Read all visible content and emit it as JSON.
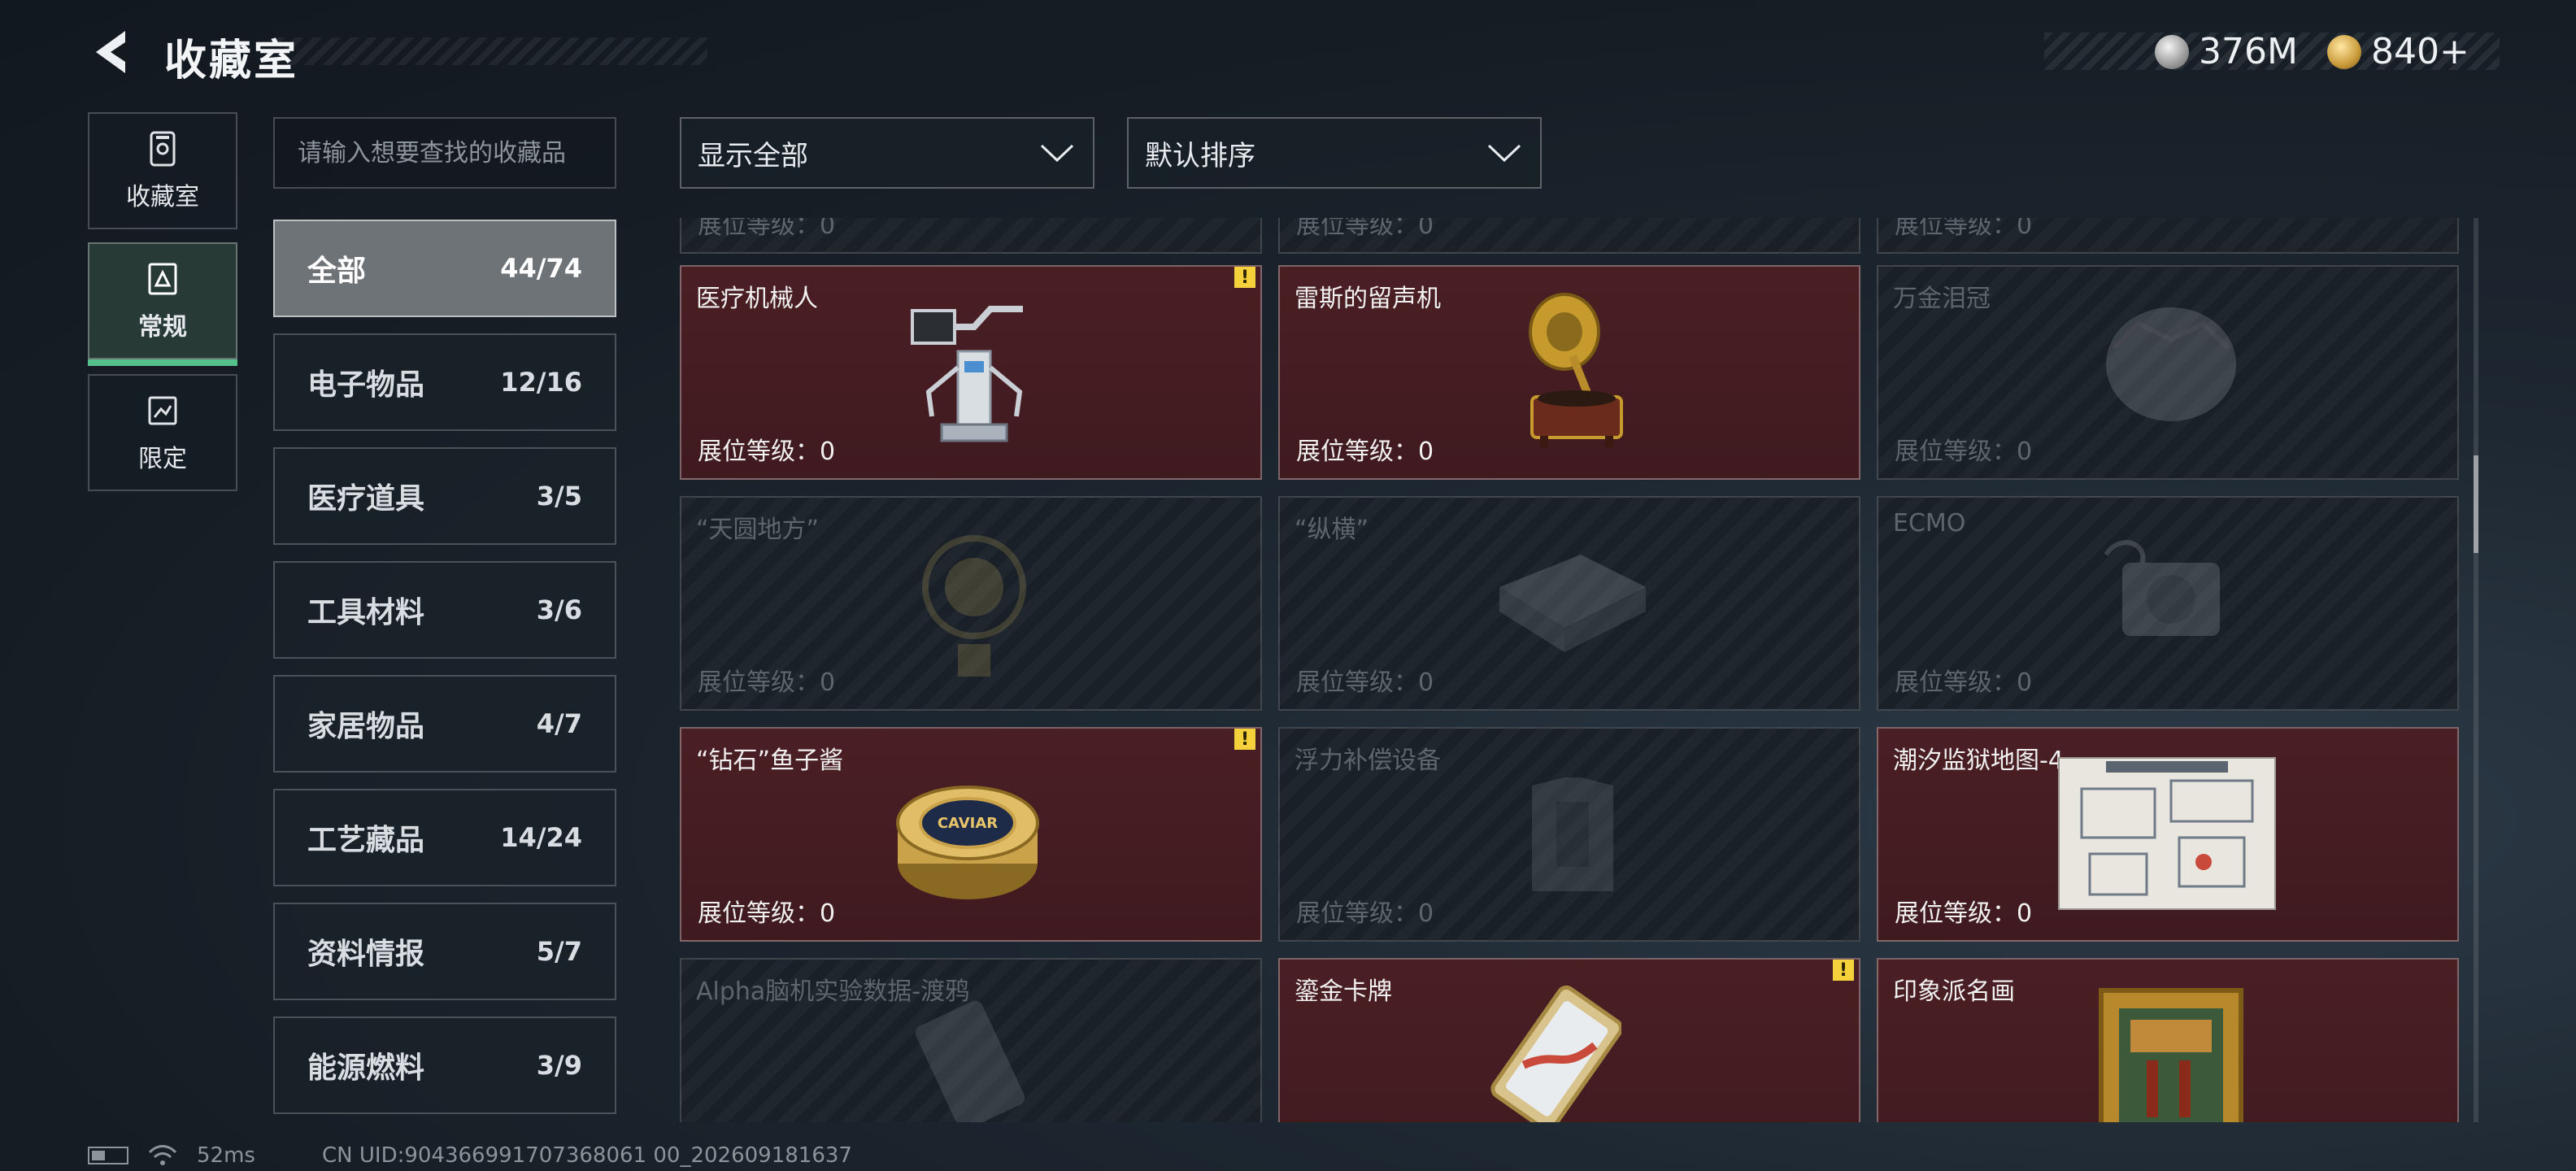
{
  "header": {
    "title": "收藏室",
    "currency": [
      {
        "icon": "silver-coin-icon",
        "value": "376M"
      },
      {
        "icon": "gold-coin-icon",
        "value": "840+"
      }
    ]
  },
  "rail": [
    {
      "label": "收藏室",
      "icon": "collection-room-icon",
      "active": false
    },
    {
      "label": "常规",
      "icon": "regular-icon",
      "active": true
    },
    {
      "label": "限定",
      "icon": "limited-icon",
      "active": false
    }
  ],
  "search": {
    "placeholder": "请输入想要查找的收藏品"
  },
  "filters": {
    "show": "显示全部",
    "sort": "默认排序"
  },
  "categories": [
    {
      "name": "全部",
      "count": "44/74",
      "active": true
    },
    {
      "name": "电子物品",
      "count": "12/16"
    },
    {
      "name": "医疗道具",
      "count": "3/5"
    },
    {
      "name": "工具材料",
      "count": "3/6"
    },
    {
      "name": "家居物品",
      "count": "4/7"
    },
    {
      "name": "工艺藏品",
      "count": "14/24"
    },
    {
      "name": "资料情报",
      "count": "5/7"
    },
    {
      "name": "能源燃料",
      "count": "3/9"
    }
  ],
  "level_label": "展位等级：0",
  "items": [
    {
      "name": "",
      "owned": false
    },
    {
      "name": "",
      "owned": false
    },
    {
      "name": "",
      "owned": false
    },
    {
      "name": "医疗机械人",
      "owned": true,
      "alert": true,
      "art": "robot"
    },
    {
      "name": "雷斯的留声机",
      "owned": true,
      "alert": false,
      "art": "gramophone"
    },
    {
      "name": "万金泪冠",
      "owned": false,
      "art": "crown"
    },
    {
      "name": "“天圆地方”",
      "owned": false,
      "art": "globe"
    },
    {
      "name": "“纵横”",
      "owned": false,
      "art": "chess"
    },
    {
      "name": "ECMO",
      "owned": false,
      "art": "ecmo"
    },
    {
      "name": "“钻石”鱼子酱",
      "owned": true,
      "alert": true,
      "art": "caviar"
    },
    {
      "name": "浮力补偿设备",
      "owned": false,
      "art": "vest"
    },
    {
      "name": "潮汐监狱地图-4",
      "owned": true,
      "alert": false,
      "art": "map"
    },
    {
      "name": "Alpha脑机实验数据-渡鸦",
      "owned": false,
      "art": "device"
    },
    {
      "name": "鎏金卡牌",
      "owned": true,
      "alert": true,
      "art": "card"
    },
    {
      "name": "印象派名画",
      "owned": true,
      "alert": false,
      "art": "painting"
    }
  ],
  "caviar_label": "CAVIAR",
  "status": {
    "ping": "52ms",
    "uid": "CN UID:904366991707368061 00_202609181637"
  }
}
